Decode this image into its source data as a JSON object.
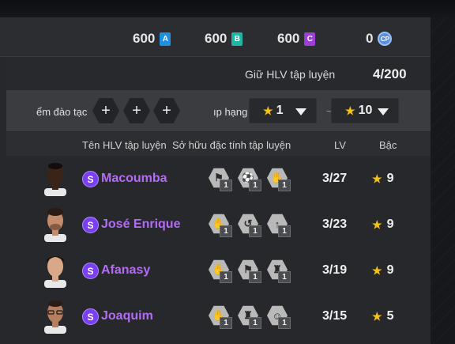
{
  "currencies": [
    {
      "amount": "600",
      "badge": "A",
      "color": "#1f8fe0"
    },
    {
      "amount": "600",
      "badge": "B",
      "color": "#1fb6a6"
    },
    {
      "amount": "600",
      "badge": "C",
      "color": "#9b3fd6"
    },
    {
      "amount": "0",
      "badge": "CP",
      "color": "#5a8ee0"
    }
  ],
  "hold": {
    "label": "Giữ HLV tập luyện",
    "value": "4/200"
  },
  "filters": {
    "skill_label": "ểm đào tạc",
    "plus_glyph": "+",
    "rank_label": "ıp hạng",
    "tilde": "~",
    "rank_min": "1",
    "rank_max": "10",
    "star_glyph": "★"
  },
  "headers": {
    "name": "Tên HLV tập luyện",
    "traits": "Sở hữu đặc tính tập luyện",
    "lv": "LV",
    "grade": "Bậc"
  },
  "coaches": [
    {
      "badge": "S",
      "name": "Macoumba",
      "traits": [
        {
          "icon": "trait-icon",
          "level": "1"
        },
        {
          "icon": "trait-icon",
          "level": "1"
        },
        {
          "icon": "trait-icon",
          "level": "1"
        }
      ],
      "lv": "3/27",
      "grade": "9"
    },
    {
      "badge": "S",
      "name": "José Enrique",
      "traits": [
        {
          "icon": "trait-icon",
          "level": "1"
        },
        {
          "icon": "trait-icon",
          "level": "1"
        },
        {
          "icon": "trait-icon",
          "level": "1"
        }
      ],
      "lv": "3/23",
      "grade": "9"
    },
    {
      "badge": "S",
      "name": "Afanasy",
      "traits": [
        {
          "icon": "trait-icon",
          "level": "1"
        },
        {
          "icon": "trait-icon",
          "level": "1"
        },
        {
          "icon": "trait-icon",
          "level": "1"
        }
      ],
      "lv": "3/19",
      "grade": "9"
    },
    {
      "badge": "S",
      "name": "Joaquim",
      "traits": [
        {
          "icon": "trait-icon",
          "level": "1"
        },
        {
          "icon": "trait-icon",
          "level": "1"
        },
        {
          "icon": "trait-icon",
          "level": "1"
        }
      ],
      "lv": "3/15",
      "grade": "5"
    }
  ],
  "colors": {
    "accent_name": "#b46cf4",
    "star": "#f2c21b",
    "s_badge": "#7a3ff0"
  }
}
